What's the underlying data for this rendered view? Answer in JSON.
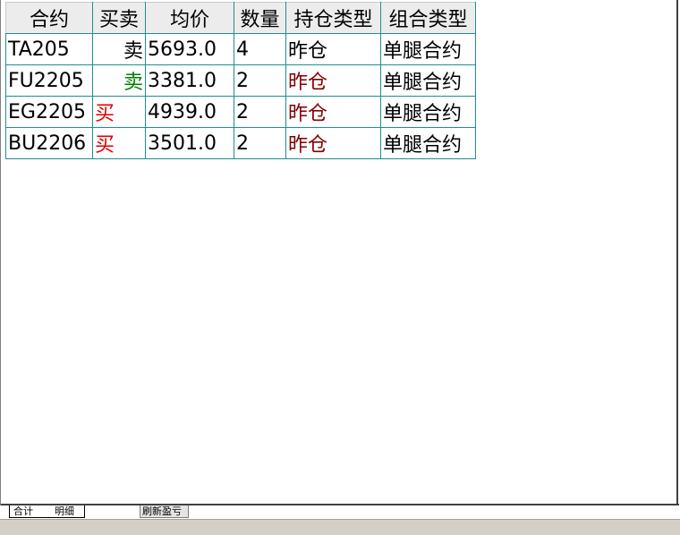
{
  "table": {
    "headers": [
      "合约",
      "买卖",
      "均价",
      "数量",
      "持仓类型",
      "组合类型"
    ],
    "rows": [
      {
        "contract": "TA205",
        "side": "卖",
        "side_color": "#000000",
        "price": "5693.0",
        "qty": "4",
        "position_type": "昨仓",
        "position_color": "#000000",
        "combo_type": "单腿合约"
      },
      {
        "contract": "FU2205",
        "side": "卖",
        "side_color": "#008000",
        "price": "3381.0",
        "qty": "2",
        "position_type": "昨仓",
        "position_color": "#800000",
        "combo_type": "单腿合约"
      },
      {
        "contract": "EG2205",
        "side": "买",
        "side_color": "#e00000",
        "price": "4939.0",
        "qty": "2",
        "position_type": "昨仓",
        "position_color": "#800000",
        "combo_type": "单腿合约"
      },
      {
        "contract": "BU2206",
        "side": "买",
        "side_color": "#e00000",
        "price": "3501.0",
        "qty": "2",
        "position_type": "昨仓",
        "position_color": "#800000",
        "combo_type": "单腿合约"
      }
    ]
  },
  "tabs": {
    "total": "合计",
    "detail": "明细",
    "refresh": "刷新盈亏"
  },
  "colors": {
    "grid_line": "#1f8f8f",
    "sell_green": "#008000",
    "buy_red": "#e00000",
    "yesterday_dark_red": "#800000"
  }
}
